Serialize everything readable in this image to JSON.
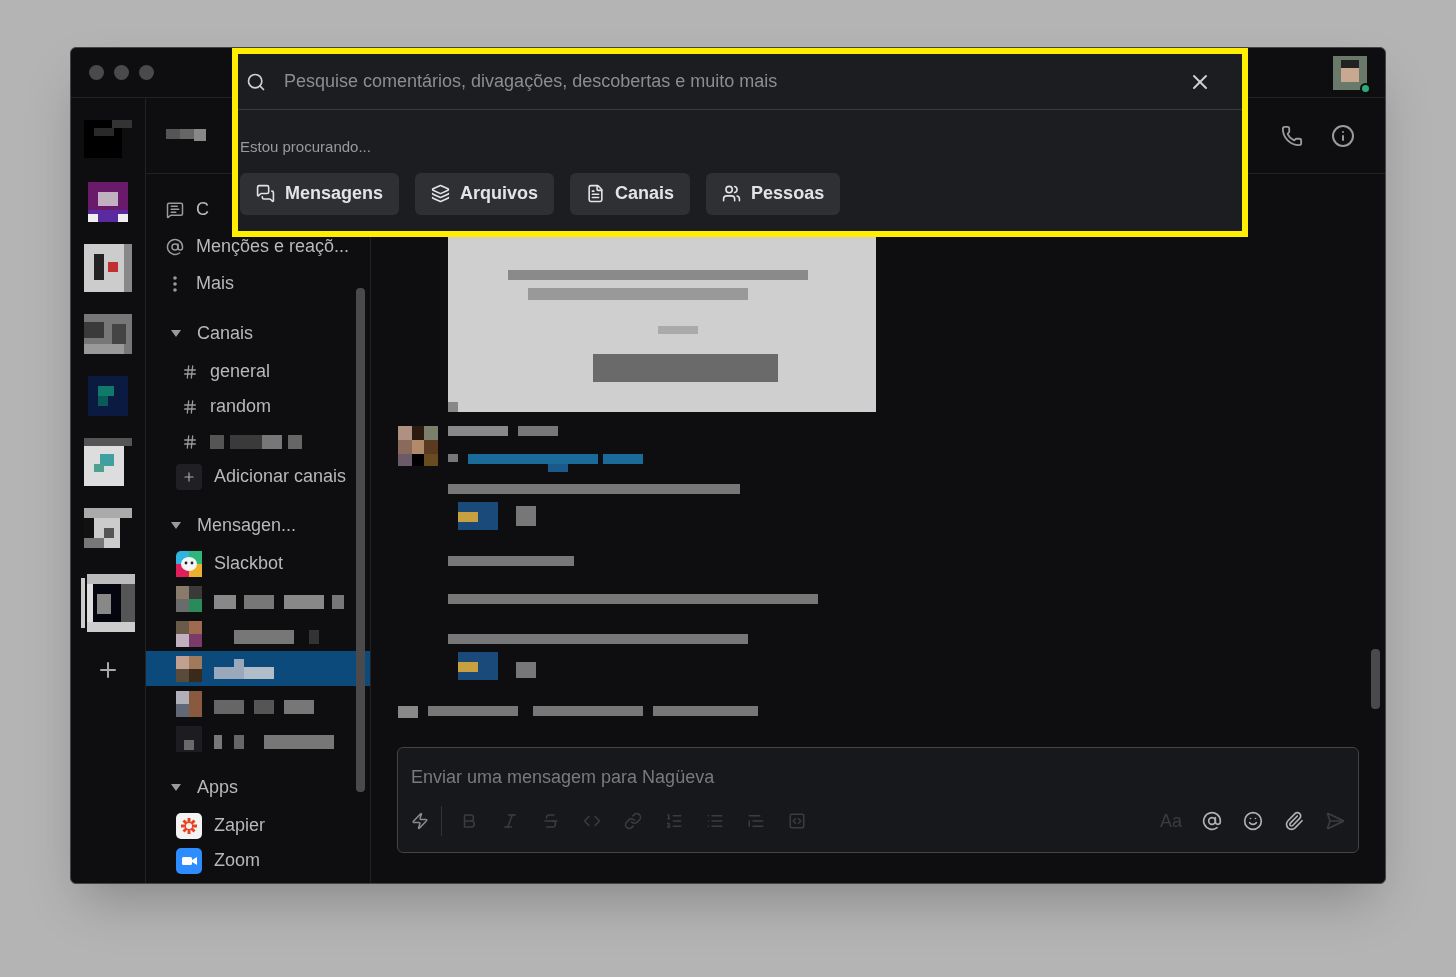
{
  "search": {
    "placeholder": "Pesquise comentários, divagações, descobertas e muito mais",
    "hint": "Estou procurando...",
    "filters": [
      {
        "label": "Mensagens",
        "kind": "messages"
      },
      {
        "label": "Arquivos",
        "kind": "files"
      },
      {
        "label": "Canais",
        "kind": "channels"
      },
      {
        "label": "Pessoas",
        "kind": "people"
      }
    ]
  },
  "sidebar": {
    "nav": [
      {
        "label": "C",
        "kind": "threads"
      },
      {
        "label": "Menções e reaçõ...",
        "kind": "mentions"
      },
      {
        "label": "Mais",
        "kind": "more"
      }
    ],
    "sections": [
      {
        "title": "Canais",
        "expanded": true,
        "items": [
          {
            "kind": "channel",
            "label": "general",
            "selected": false
          },
          {
            "kind": "channel",
            "label": "random",
            "selected": false
          },
          {
            "kind": "channel-hidden",
            "selected": false
          },
          {
            "kind": "add",
            "label": "Adicionar canais",
            "selected": false
          }
        ]
      },
      {
        "title": "Mensagen...",
        "expanded": true,
        "items": [
          {
            "kind": "slackbot",
            "label": "Slackbot",
            "selected": false
          },
          {
            "kind": "dm-hidden",
            "selected": false
          },
          {
            "kind": "dm-hidden",
            "selected": false
          },
          {
            "kind": "dm-hidden",
            "selected": true
          },
          {
            "kind": "dm-hidden",
            "selected": false
          },
          {
            "kind": "dm-hidden",
            "selected": false
          }
        ]
      },
      {
        "title": "Apps",
        "expanded": true,
        "items": [
          {
            "kind": "zapier",
            "label": "Zapier",
            "selected": false
          },
          {
            "kind": "zoom",
            "label": "Zoom",
            "selected": false
          }
        ]
      }
    ]
  },
  "composer": {
    "placeholder": "Enviar uma mensagem para Nagüeva",
    "format_label": "Aa"
  }
}
